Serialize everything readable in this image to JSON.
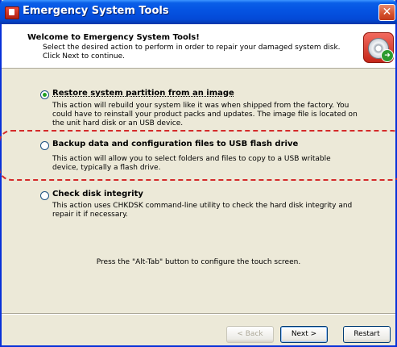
{
  "window": {
    "title": "Emergency System Tools"
  },
  "header": {
    "title": "Welcome to Emergency System Tools!",
    "description": "Select the desired action to perform in order to repair your damaged system disk. Click Next to continue."
  },
  "options": [
    {
      "label": "Restore system partition from an image",
      "description": "This action will rebuild your system like it was when shipped from the factory. You could have to reinstall your product packs and updates. The image file is located on the unit hard disk or an USB device.",
      "selected": true
    },
    {
      "label": "Backup data and configuration files to USB flash drive",
      "description": "This action will allow you to select folders and files to copy to a USB writable device, typically a flash drive.",
      "selected": false
    },
    {
      "label": "Check disk integrity",
      "description": "This action uses CHKDSK command-line utility to check the hard disk integrity and repair it if necessary.",
      "selected": false
    }
  ],
  "hint": "Press the \"Alt-Tab\" button to configure the touch screen.",
  "buttons": {
    "back": "< Back",
    "next": "Next >",
    "restart": "Restart"
  },
  "icons": {
    "app": "app-icon",
    "header": "disc-repair-icon",
    "close": "close-icon"
  },
  "colors": {
    "titlebar": "#0554e3",
    "highlight": "#d42a2a",
    "radio_checked": "#21a121"
  }
}
